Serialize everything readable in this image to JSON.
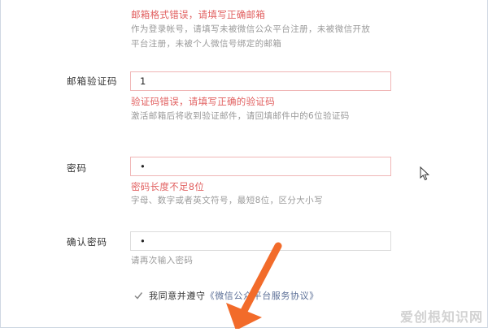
{
  "email": {
    "error": "邮箱格式错误，请填写正确邮箱",
    "tip": "作为登录帐号，请填写未被微信公众平台注册，未被微信开放平台注册，未被个人微信号绑定的邮箱"
  },
  "verify_code": {
    "label": "邮箱验证码",
    "value": "1",
    "error": "验证码错误，请填写正确的验证码",
    "tip": "激活邮箱后将收到验证邮件，请回填邮件中的6位验证码"
  },
  "password": {
    "label": "密码",
    "value": "•",
    "error": "密码长度不足8位",
    "tip": "字母、数字或者英文符号，最短8位，区分大小写"
  },
  "confirm_password": {
    "label": "确认密码",
    "value": "•",
    "tip": "请再次输入密码"
  },
  "agreement": {
    "prefix": "我同意并遵守",
    "link": "《微信公众平台服务协议》"
  },
  "watermark": "爱创根知识网",
  "icons": {
    "checkbox": "check-icon",
    "cursor": "mouse-pointer-icon",
    "arrow": "annotation-arrow-icon"
  },
  "colors": {
    "error": "#e15f5f",
    "arrow": "#f26b2a",
    "tip": "#9a9a9a"
  }
}
